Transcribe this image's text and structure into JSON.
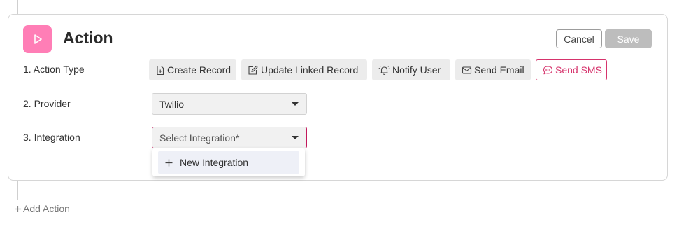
{
  "header": {
    "title": "Action",
    "icon": "play-icon",
    "accent_color": "#ff7eb6",
    "cancel_label": "Cancel",
    "save_label": "Save"
  },
  "rows": {
    "action_type_label": "1. Action Type",
    "provider_label": "2. Provider",
    "integration_label": "3. Integration"
  },
  "action_types": [
    {
      "label": "Create Record",
      "icon": "file-plus-icon"
    },
    {
      "label": "Update Linked Record",
      "icon": "edit-icon"
    },
    {
      "label": "Notify User",
      "icon": "bell-icon"
    },
    {
      "label": "Send Email",
      "icon": "mail-icon"
    },
    {
      "label": "Send SMS",
      "icon": "message-icon",
      "selected": true
    }
  ],
  "provider": {
    "value": "Twilio"
  },
  "integration": {
    "placeholder": "Select Integration*"
  },
  "dropdown": {
    "new_integration_label": "New Integration"
  },
  "footer": {
    "add_action_label": "Add Action"
  },
  "colors": {
    "active": "#d6336c",
    "save_disabled": "#bdbdbd"
  }
}
